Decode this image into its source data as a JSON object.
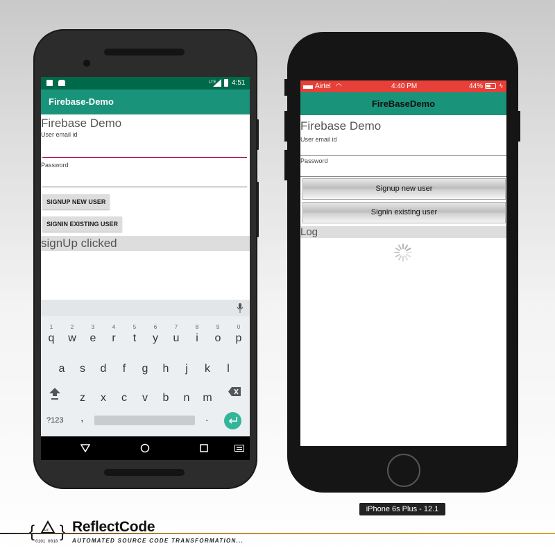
{
  "android": {
    "status": {
      "time": "4:51",
      "signal_label": "LTE"
    },
    "appbar_title": "Firebase-Demo",
    "heading": "Firebase Demo",
    "email_label": "User email id",
    "password_label": "Password",
    "signup_button": "SIGNUP NEW USER",
    "signin_button": "SIGNIN EXISTING USER",
    "log_text": "signUp clicked",
    "colors": {
      "status_bar": "#00694a",
      "app_bar": "#19937a",
      "focus_line": "#b0356b",
      "enter_key": "#33b59a"
    },
    "keyboard": {
      "row1": [
        "q",
        "w",
        "e",
        "r",
        "t",
        "y",
        "u",
        "i",
        "o",
        "p"
      ],
      "row1_hints": [
        "1",
        "2",
        "3",
        "4",
        "5",
        "6",
        "7",
        "8",
        "9",
        "0"
      ],
      "row2": [
        "a",
        "s",
        "d",
        "f",
        "g",
        "h",
        "j",
        "k",
        "l"
      ],
      "row3": [
        "z",
        "x",
        "c",
        "v",
        "b",
        "n",
        "m"
      ],
      "symbols_key": "?123",
      "comma_key": ",",
      "period_key": "."
    }
  },
  "iphone": {
    "status": {
      "carrier": "Airtel",
      "time": "4:40 PM",
      "battery": "44%"
    },
    "nav_title": "FireBaseDemo",
    "heading": "Firebase Demo",
    "email_label": "User email id",
    "password_label": "Password",
    "signup_button": "Signup new user",
    "signin_button": "Signin existing user",
    "log_text": "Log",
    "colors": {
      "status_bar": "#e64039",
      "nav_bar": "#19937a"
    }
  },
  "simulator_caption": "iPhone 6s Plus - 12.1",
  "footer": {
    "brand": "ReflectCode",
    "tagline": "AUTOMATED SOURCE CODE TRANSFORMATION...",
    "logo_text": "0101 0010",
    "logo_rc": "RC"
  }
}
